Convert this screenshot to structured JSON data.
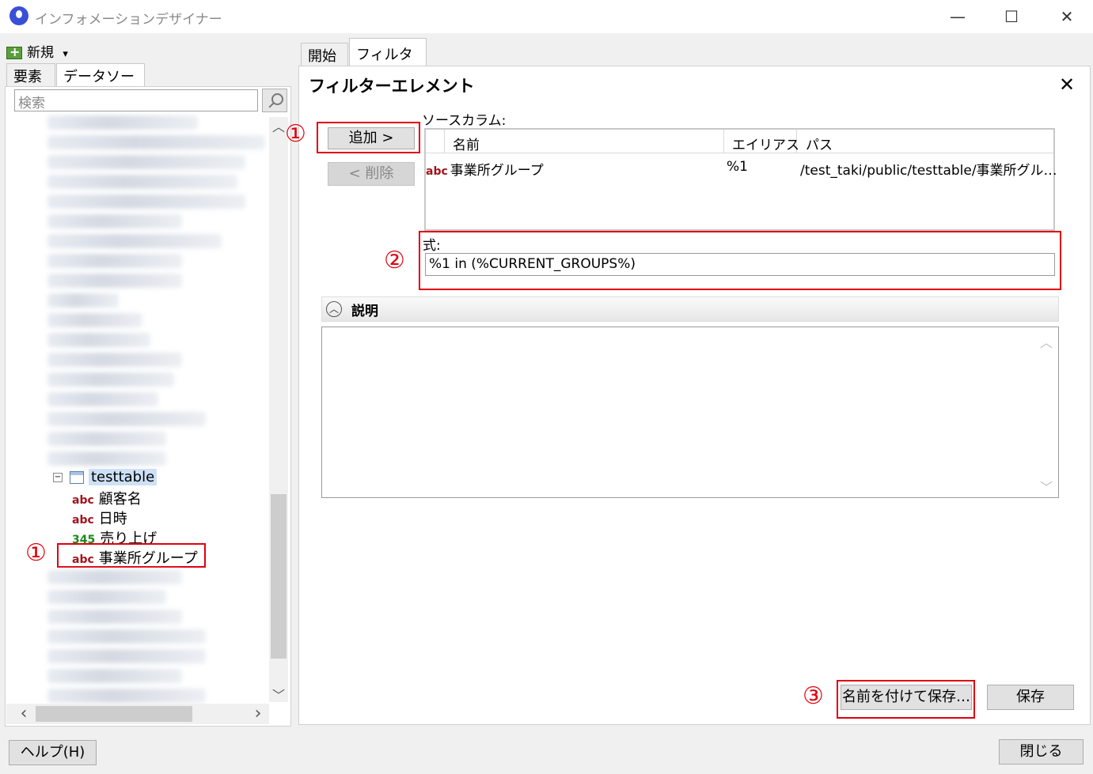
{
  "window": {
    "title": "インフォメーションデザイナー",
    "minimize": "—",
    "maximize": "☐",
    "close": "✕"
  },
  "left_panel": {
    "new_label": "新規",
    "new_dropdown": "▾",
    "tabs": [
      "要素",
      "データソース"
    ],
    "search_placeholder": "検索",
    "tree": {
      "table": "testtable",
      "expander": "−",
      "columns": [
        {
          "type": "abc",
          "name": "顧客名"
        },
        {
          "type": "abc",
          "name": "日時"
        },
        {
          "type": "345",
          "name": "売り上げ"
        },
        {
          "type": "abc",
          "name": "事業所グループ"
        }
      ]
    },
    "scroll_up": "︿",
    "scroll_down": "﹀",
    "scroll_left": "‹",
    "scroll_right": "›"
  },
  "right_panel": {
    "tabs": [
      "開始",
      "フィルター*"
    ],
    "heading": "フィルターエレメント",
    "close": "✕",
    "add_button": "追加 >",
    "remove_button": "< 削除",
    "source_columns_label": "ソースカラム:",
    "grid_headers": [
      "名前",
      "エイリアス",
      "パス"
    ],
    "grid_rows": [
      {
        "type": "abc",
        "name": "事業所グループ",
        "alias": "%1",
        "path": "/test_taki/public/testtable/事業所グル…"
      }
    ],
    "expression_label": "式:",
    "expression_value": "%1 in (%CURRENT_GROUPS%)",
    "description_label": "説明",
    "collapse_icon": "︿",
    "save_as_button": "名前を付けて保存…",
    "save_button": "保存"
  },
  "footer": {
    "help_button": "ヘルプ(H)",
    "close_button": "閉じる"
  },
  "annotations": [
    "①",
    "①",
    "②",
    "③"
  ],
  "colors": {
    "annotation_red": "#e0000f",
    "string_type": "#a0141c",
    "number_type": "#1a8a1a"
  }
}
